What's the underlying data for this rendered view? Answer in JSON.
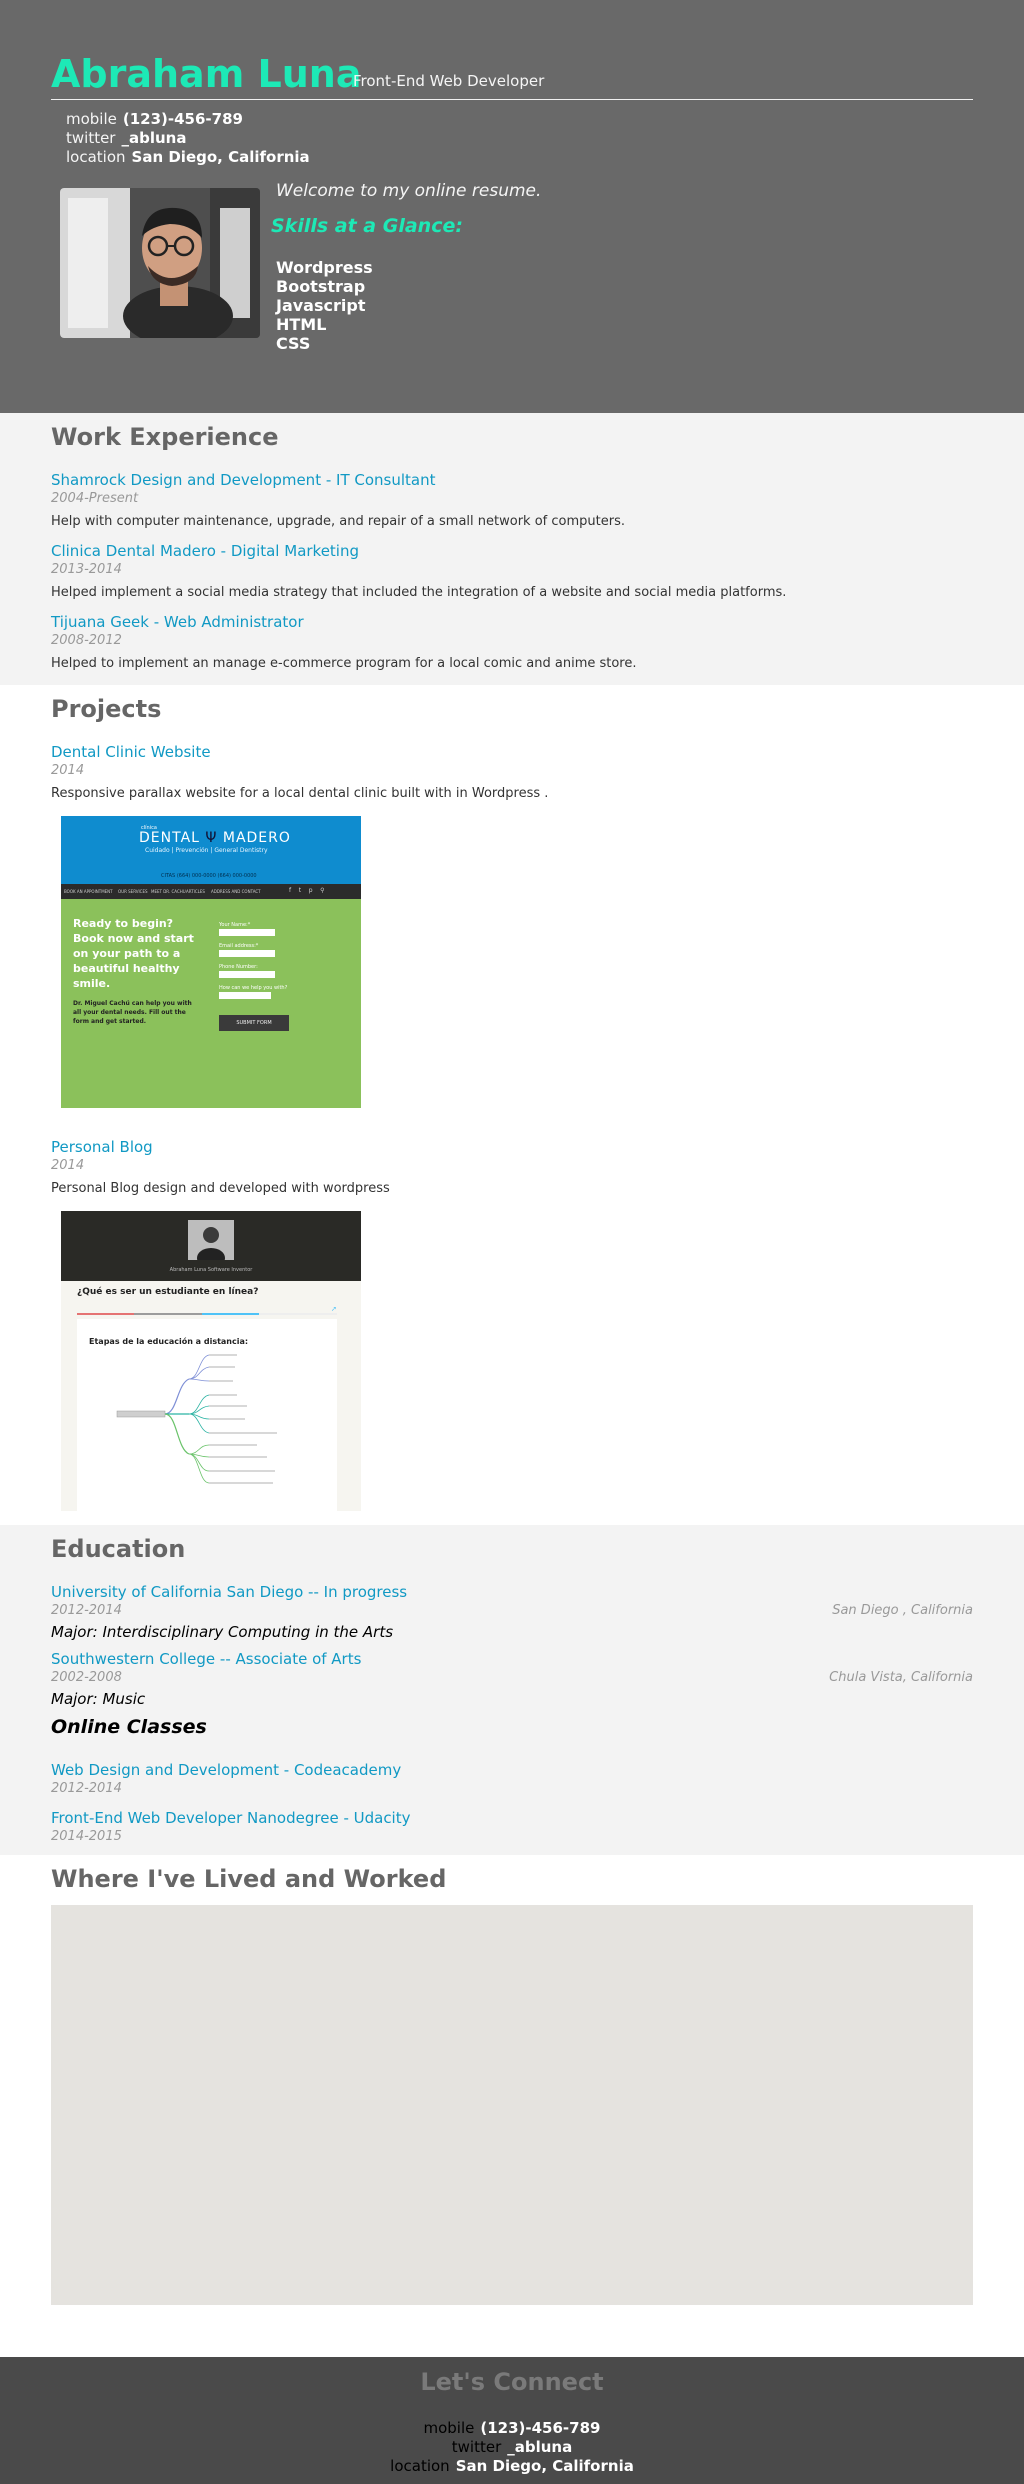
{
  "header": {
    "name": "Abraham Luna",
    "role": "Front-End Web Developer",
    "contacts": [
      {
        "key": "mobile",
        "value": "(123)-456-789"
      },
      {
        "key": "twitter",
        "value": "_abluna"
      },
      {
        "key": "location",
        "value": "San Diego, California"
      }
    ],
    "welcome": "Welcome to my online resume.",
    "skills_heading": "Skills at a Glance:",
    "skills": [
      "Wordpress",
      "Bootstrap",
      "Javascript",
      "HTML",
      "CSS"
    ]
  },
  "work": {
    "title": "Work Experience",
    "jobs": [
      {
        "title": "Shamrock Design and Development - IT Consultant",
        "dates": "2004-Present",
        "desc": "Help with computer maintenance, upgrade, and repair of a small network of computers."
      },
      {
        "title": "Clinica Dental Madero - Digital Marketing",
        "dates": "2013-2014",
        "desc": "Helped implement a social media strategy that included the integration of a website and social media platforms."
      },
      {
        "title": "Tijuana Geek - Web Administrator",
        "dates": "2008-2012",
        "desc": "Helped to implement an manage e-commerce program for a local comic and anime store."
      }
    ]
  },
  "projects": {
    "title": "Projects",
    "items": [
      {
        "title": "Dental Clinic Website",
        "dates": "2014",
        "desc": "Responsive parallax website for a local dental clinic built with in Wordpress .",
        "shot": {
          "brand_small": "clínica",
          "brand": "DENTAL",
          "brand2": "MADERO",
          "tagline": "Cuidado | Prevención | General Dentistry",
          "phone": "CITAS (664) 000-0000  (664) 000-0000",
          "nav": [
            "BOOK AN APPOINTMENT",
            "OUR SERVICES",
            "MEET DR. CACHU",
            "ARTICLES",
            "ADDRESS AND CONTACT"
          ],
          "hero_text": "Ready to begin? Book now and start on your path to a beautiful healthy  smile.",
          "sub_text": "Dr. Miguel Cachú can help you with all your dental needs. Fill out the form and get started.",
          "labels": [
            "Your Name:*",
            "Email address:*",
            "Phone Number:",
            "How can we help you with?"
          ],
          "submit": "SUBMIT FORM"
        }
      },
      {
        "title": "Personal Blog",
        "dates": "2014",
        "desc": "Personal Blog design and developed with wordpress",
        "shot": {
          "byline": "Abraham Luna Software Inventor",
          "post_title": "¿Qué es ser un estudiante en línea?",
          "diagram_title": "Etapas  de la educación a distancia:"
        }
      }
    ]
  },
  "education": {
    "title": "Education",
    "schools": [
      {
        "title": "University of California San Diego -- In progress",
        "dates": "2012-2014",
        "location": "San Diego , California",
        "major": "Major: Interdisciplinary Computing in the Arts"
      },
      {
        "title": "Southwestern College -- Associate of Arts",
        "dates": "2002-2008",
        "location": "Chula Vista, California",
        "major": "Major: Music"
      }
    ],
    "online_heading": "Online Classes",
    "online": [
      {
        "title": "Web Design and Development - Codeacademy",
        "dates": "2012-2014"
      },
      {
        "title": "Front-End Web Developer Nanodegree - Udacity",
        "dates": "2014-2015"
      }
    ]
  },
  "map": {
    "title": "Where I've Lived and Worked"
  },
  "footer": {
    "title": "Let's Connect",
    "contacts": [
      {
        "key": "mobile",
        "value": "(123)-456-789"
      },
      {
        "key": "twitter",
        "value": "_abluna"
      },
      {
        "key": "location",
        "value": "San Diego, California"
      }
    ]
  },
  "colors": {
    "accent": "#1de9b6",
    "link": "#1199c4",
    "header_bg": "#696969",
    "section_bg": "#f3f3f3",
    "footer_bg": "#4a4a4a",
    "map_bg": "#e5e3df"
  }
}
